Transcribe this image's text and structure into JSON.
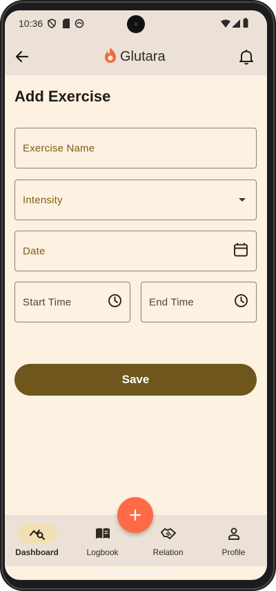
{
  "status_bar": {
    "time": "10:36"
  },
  "app_bar": {
    "title": "Glutara",
    "colors": {
      "logo_flame": "#f26a3d"
    }
  },
  "page": {
    "title": "Add Exercise"
  },
  "form": {
    "exercise_name": {
      "label": "Exercise Name"
    },
    "intensity": {
      "label": "Intensity"
    },
    "date": {
      "label": "Date"
    },
    "start_time": {
      "label": "Start Time"
    },
    "end_time": {
      "label": "End Time"
    },
    "save_label": "Save"
  },
  "fab": {
    "icon": "plus-icon"
  },
  "bottom_nav": {
    "items": [
      {
        "label": "Dashboard",
        "icon": "dashboard-icon",
        "active": true
      },
      {
        "label": "Logbook",
        "icon": "book-icon",
        "active": false
      },
      {
        "label": "Relation",
        "icon": "handshake-icon",
        "active": false
      },
      {
        "label": "Profile",
        "icon": "person-icon",
        "active": false
      }
    ]
  },
  "colors": {
    "background": "#fdf1e2",
    "bar_background": "#ece1d6",
    "primary": "#6e561c",
    "fab": "#ff6a47",
    "active_indicator": "#f3dfb4"
  }
}
